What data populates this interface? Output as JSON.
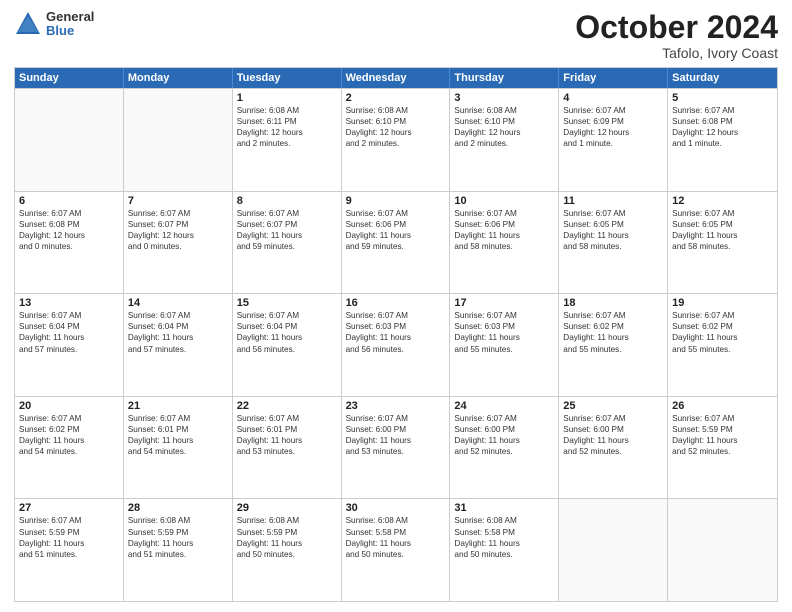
{
  "logo": {
    "general": "General",
    "blue": "Blue"
  },
  "header": {
    "month": "October 2024",
    "location": "Tafolo, Ivory Coast"
  },
  "weekdays": [
    "Sunday",
    "Monday",
    "Tuesday",
    "Wednesday",
    "Thursday",
    "Friday",
    "Saturday"
  ],
  "weeks": [
    [
      {
        "day": "",
        "lines": []
      },
      {
        "day": "",
        "lines": []
      },
      {
        "day": "1",
        "lines": [
          "Sunrise: 6:08 AM",
          "Sunset: 6:11 PM",
          "Daylight: 12 hours",
          "and 2 minutes."
        ]
      },
      {
        "day": "2",
        "lines": [
          "Sunrise: 6:08 AM",
          "Sunset: 6:10 PM",
          "Daylight: 12 hours",
          "and 2 minutes."
        ]
      },
      {
        "day": "3",
        "lines": [
          "Sunrise: 6:08 AM",
          "Sunset: 6:10 PM",
          "Daylight: 12 hours",
          "and 2 minutes."
        ]
      },
      {
        "day": "4",
        "lines": [
          "Sunrise: 6:07 AM",
          "Sunset: 6:09 PM",
          "Daylight: 12 hours",
          "and 1 minute."
        ]
      },
      {
        "day": "5",
        "lines": [
          "Sunrise: 6:07 AM",
          "Sunset: 6:08 PM",
          "Daylight: 12 hours",
          "and 1 minute."
        ]
      }
    ],
    [
      {
        "day": "6",
        "lines": [
          "Sunrise: 6:07 AM",
          "Sunset: 6:08 PM",
          "Daylight: 12 hours",
          "and 0 minutes."
        ]
      },
      {
        "day": "7",
        "lines": [
          "Sunrise: 6:07 AM",
          "Sunset: 6:07 PM",
          "Daylight: 12 hours",
          "and 0 minutes."
        ]
      },
      {
        "day": "8",
        "lines": [
          "Sunrise: 6:07 AM",
          "Sunset: 6:07 PM",
          "Daylight: 11 hours",
          "and 59 minutes."
        ]
      },
      {
        "day": "9",
        "lines": [
          "Sunrise: 6:07 AM",
          "Sunset: 6:06 PM",
          "Daylight: 11 hours",
          "and 59 minutes."
        ]
      },
      {
        "day": "10",
        "lines": [
          "Sunrise: 6:07 AM",
          "Sunset: 6:06 PM",
          "Daylight: 11 hours",
          "and 58 minutes."
        ]
      },
      {
        "day": "11",
        "lines": [
          "Sunrise: 6:07 AM",
          "Sunset: 6:05 PM",
          "Daylight: 11 hours",
          "and 58 minutes."
        ]
      },
      {
        "day": "12",
        "lines": [
          "Sunrise: 6:07 AM",
          "Sunset: 6:05 PM",
          "Daylight: 11 hours",
          "and 58 minutes."
        ]
      }
    ],
    [
      {
        "day": "13",
        "lines": [
          "Sunrise: 6:07 AM",
          "Sunset: 6:04 PM",
          "Daylight: 11 hours",
          "and 57 minutes."
        ]
      },
      {
        "day": "14",
        "lines": [
          "Sunrise: 6:07 AM",
          "Sunset: 6:04 PM",
          "Daylight: 11 hours",
          "and 57 minutes."
        ]
      },
      {
        "day": "15",
        "lines": [
          "Sunrise: 6:07 AM",
          "Sunset: 6:04 PM",
          "Daylight: 11 hours",
          "and 56 minutes."
        ]
      },
      {
        "day": "16",
        "lines": [
          "Sunrise: 6:07 AM",
          "Sunset: 6:03 PM",
          "Daylight: 11 hours",
          "and 56 minutes."
        ]
      },
      {
        "day": "17",
        "lines": [
          "Sunrise: 6:07 AM",
          "Sunset: 6:03 PM",
          "Daylight: 11 hours",
          "and 55 minutes."
        ]
      },
      {
        "day": "18",
        "lines": [
          "Sunrise: 6:07 AM",
          "Sunset: 6:02 PM",
          "Daylight: 11 hours",
          "and 55 minutes."
        ]
      },
      {
        "day": "19",
        "lines": [
          "Sunrise: 6:07 AM",
          "Sunset: 6:02 PM",
          "Daylight: 11 hours",
          "and 55 minutes."
        ]
      }
    ],
    [
      {
        "day": "20",
        "lines": [
          "Sunrise: 6:07 AM",
          "Sunset: 6:02 PM",
          "Daylight: 11 hours",
          "and 54 minutes."
        ]
      },
      {
        "day": "21",
        "lines": [
          "Sunrise: 6:07 AM",
          "Sunset: 6:01 PM",
          "Daylight: 11 hours",
          "and 54 minutes."
        ]
      },
      {
        "day": "22",
        "lines": [
          "Sunrise: 6:07 AM",
          "Sunset: 6:01 PM",
          "Daylight: 11 hours",
          "and 53 minutes."
        ]
      },
      {
        "day": "23",
        "lines": [
          "Sunrise: 6:07 AM",
          "Sunset: 6:00 PM",
          "Daylight: 11 hours",
          "and 53 minutes."
        ]
      },
      {
        "day": "24",
        "lines": [
          "Sunrise: 6:07 AM",
          "Sunset: 6:00 PM",
          "Daylight: 11 hours",
          "and 52 minutes."
        ]
      },
      {
        "day": "25",
        "lines": [
          "Sunrise: 6:07 AM",
          "Sunset: 6:00 PM",
          "Daylight: 11 hours",
          "and 52 minutes."
        ]
      },
      {
        "day": "26",
        "lines": [
          "Sunrise: 6:07 AM",
          "Sunset: 5:59 PM",
          "Daylight: 11 hours",
          "and 52 minutes."
        ]
      }
    ],
    [
      {
        "day": "27",
        "lines": [
          "Sunrise: 6:07 AM",
          "Sunset: 5:59 PM",
          "Daylight: 11 hours",
          "and 51 minutes."
        ]
      },
      {
        "day": "28",
        "lines": [
          "Sunrise: 6:08 AM",
          "Sunset: 5:59 PM",
          "Daylight: 11 hours",
          "and 51 minutes."
        ]
      },
      {
        "day": "29",
        "lines": [
          "Sunrise: 6:08 AM",
          "Sunset: 5:59 PM",
          "Daylight: 11 hours",
          "and 50 minutes."
        ]
      },
      {
        "day": "30",
        "lines": [
          "Sunrise: 6:08 AM",
          "Sunset: 5:58 PM",
          "Daylight: 11 hours",
          "and 50 minutes."
        ]
      },
      {
        "day": "31",
        "lines": [
          "Sunrise: 6:08 AM",
          "Sunset: 5:58 PM",
          "Daylight: 11 hours",
          "and 50 minutes."
        ]
      },
      {
        "day": "",
        "lines": []
      },
      {
        "day": "",
        "lines": []
      }
    ]
  ]
}
